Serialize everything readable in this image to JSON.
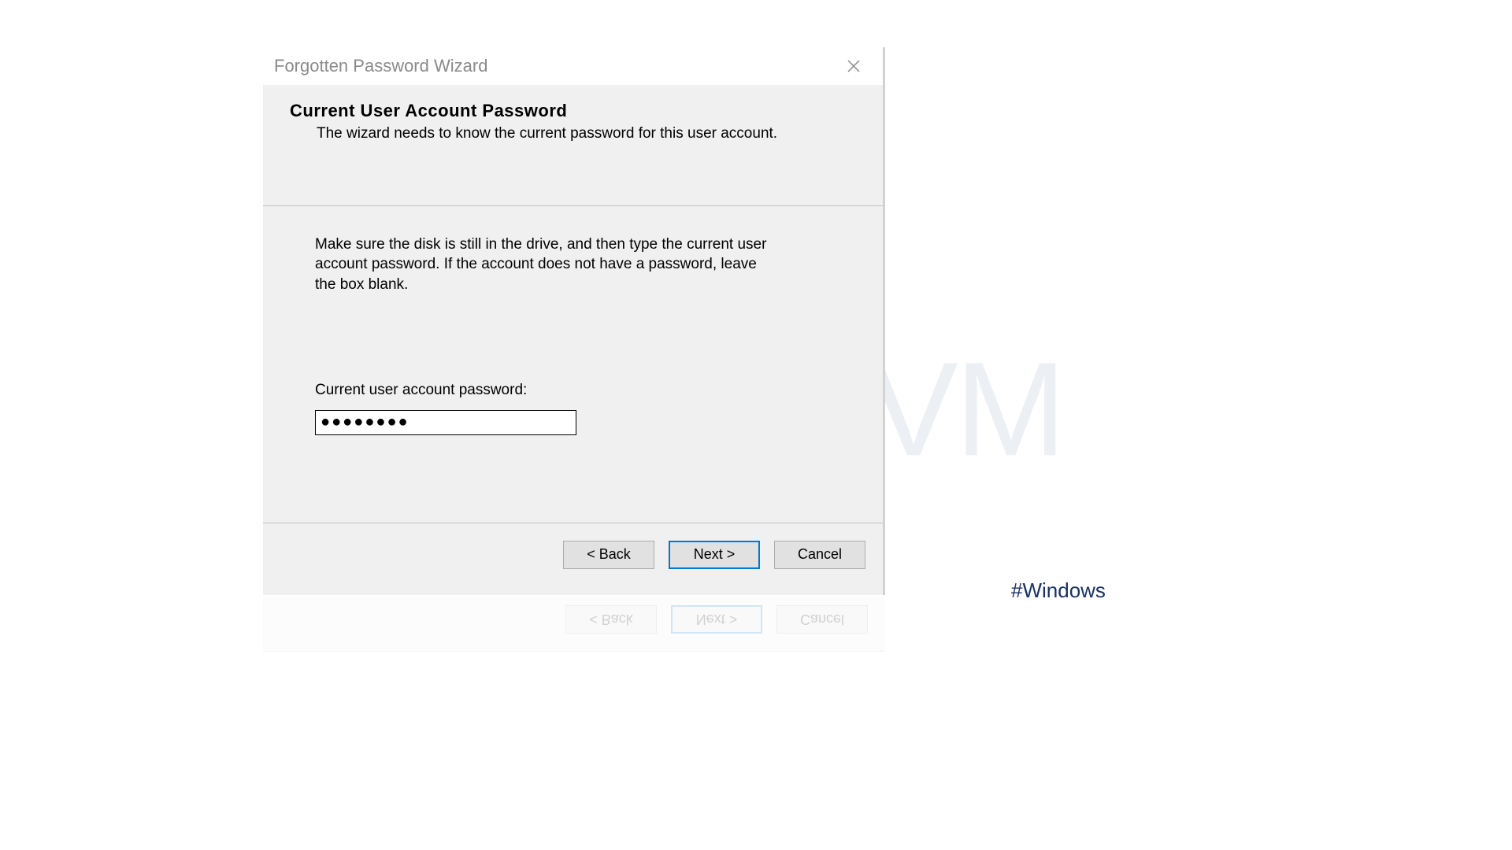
{
  "dialog": {
    "title": "Forgotten Password Wizard",
    "header": {
      "title": "Current User Account Password",
      "subtitle": "The wizard needs to know the current password for this user account."
    },
    "content": {
      "instruction": "Make sure the disk is still in the drive, and then type the current user account password. If the account does not have a password, leave the box blank.",
      "password_label": "Current user account password:",
      "password_value": "●●●●●●●●"
    },
    "buttons": {
      "back": "< Back",
      "next": "Next >",
      "cancel": "Cancel"
    }
  },
  "watermark": "NeuronVM",
  "hashtag": "#Windows"
}
